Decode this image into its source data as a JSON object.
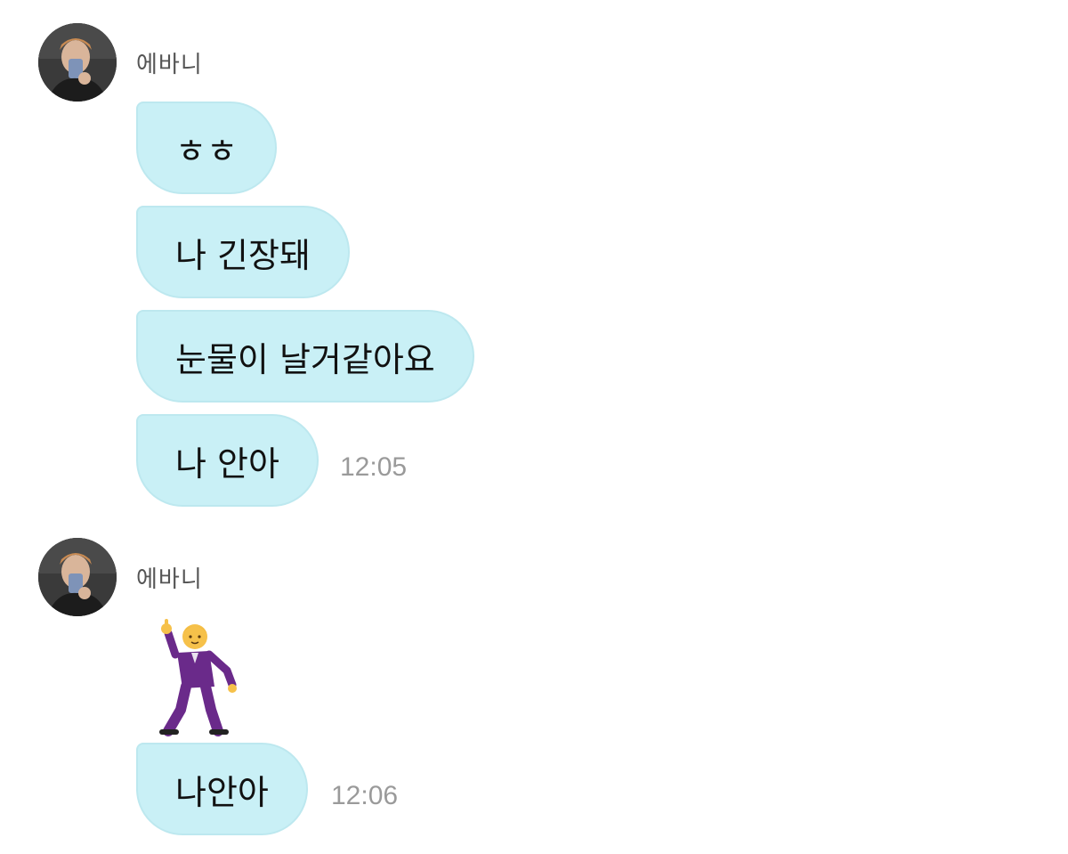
{
  "groups": [
    {
      "sender": "에바니",
      "avatar_icon": "profile-photo",
      "messages": [
        "ㅎㅎ",
        "나 긴장돼",
        "눈물이 날거같아요",
        "나 안아"
      ],
      "time": "12:05"
    },
    {
      "sender": "에바니",
      "avatar_icon": "profile-photo",
      "emoji": "man-dancing-emoji",
      "messages": [
        "나안아"
      ],
      "time": "12:06"
    }
  ],
  "colors": {
    "bubble": "#c9f0f6",
    "bubble_border": "#bde8ef",
    "time": "#9a9a9a",
    "sender": "#555555",
    "emoji_suit": "#6a2a8a",
    "emoji_skin": "#f6c14a"
  }
}
